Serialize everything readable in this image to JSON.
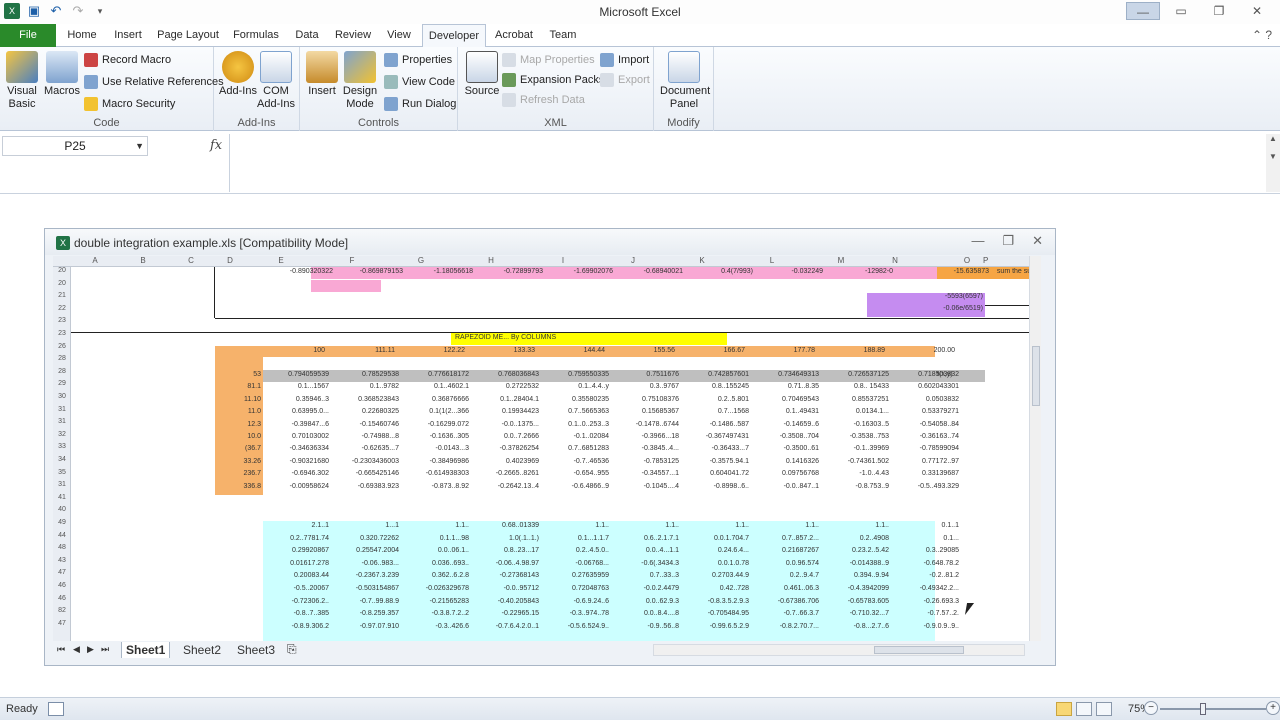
{
  "app": {
    "title": "Microsoft Excel"
  },
  "qat": {
    "save": "save-icon",
    "undo": "undo-icon",
    "redo": "redo-icon",
    "customize": "chevron-down-icon"
  },
  "tabs": [
    "File",
    "Home",
    "Insert",
    "Page Layout",
    "Formulas",
    "Data",
    "Review",
    "View",
    "Developer",
    "Acrobat",
    "Team"
  ],
  "active_tab": "Developer",
  "ribbon": {
    "code": {
      "label": "Code",
      "visual_basic": "Visual Basic",
      "macros": "Macros",
      "record_macro": "Record Macro",
      "relative_refs": "Use Relative References",
      "macro_security": "Macro Security"
    },
    "addins": {
      "label": "Add-Ins",
      "addins": "Add-Ins",
      "com_addins": "COM Add-Ins"
    },
    "controls": {
      "label": "Controls",
      "insert": "Insert",
      "design_mode": "Design Mode",
      "properties": "Properties",
      "view_code": "View Code",
      "run_dialog": "Run Dialog"
    },
    "xml": {
      "label": "XML",
      "source": "Source",
      "map_properties": "Map Properties",
      "expansion_packs": "Expansion Packs",
      "refresh_data": "Refresh Data",
      "import": "Import",
      "export": "Export"
    },
    "modify": {
      "label": "Modify",
      "document_panel": "Document Panel"
    }
  },
  "formula_bar": {
    "name_box": "P25",
    "fx": "fx",
    "formula": ""
  },
  "workbook": {
    "title": "double integration example.xls  [Compatibility Mode]",
    "columns": [
      "A",
      "B",
      "C",
      "D",
      "E",
      "F",
      "G",
      "H",
      "I",
      "J",
      "K",
      "L",
      "M",
      "N",
      "O",
      "P"
    ],
    "rows": [
      "20",
      "20",
      "21",
      "22",
      "23",
      "23",
      "26",
      "28",
      "28",
      "29",
      "30",
      "31",
      "31",
      "32",
      "33",
      "34",
      "35",
      "31",
      "41",
      "40",
      "49",
      "44",
      "48",
      "43",
      "47",
      "46",
      "46",
      "82",
      "47"
    ],
    "section_title": "RAPEZOID ME... By COLUMNS",
    "header_values": [
      "100",
      "111.11",
      "122.22",
      "133.33",
      "144.44",
      "155.56",
      "166.67",
      "177.78",
      "188.89",
      "200.00"
    ],
    "top_row_values": [
      "-0.890320322",
      "-0.869879153",
      "-1.18056618",
      "-0.72899793",
      "-1.69902076",
      "-0.68940021",
      "0.4(7/993)",
      "-0.032249",
      "-12982-0",
      "-15.635873",
      "sum the sum"
    ],
    "right_notes": {
      "a": "-5593(6597)",
      "b": "-0.06e/6519)",
      "fxy": "f(x,y)"
    },
    "orange_rows": [
      [
        "53",
        "0.794059539",
        "0.78529538",
        "0.776618172",
        "0.768036843",
        "0.759550335",
        "0.7511676",
        "0.742857601",
        "0.734649313",
        "0.726537125",
        "0.718503832"
      ],
      [
        "81.1",
        "0.1...1567",
        "0.1..9782",
        "0.1..4602.1",
        "0.2722532",
        "0.1..4.4..y",
        "0.3..9767",
        "0.8..155245",
        "0.71..8.35",
        "0.8.. 15433",
        "0.602043301"
      ],
      [
        "11.10",
        "0.35946..3",
        "0.368523843",
        "0.36876666",
        "0.1..28404.1",
        "0.35580235",
        "0.75108376",
        "0.2..5.801",
        "0.70469543",
        "0.85537251",
        "0.0503832"
      ],
      [
        "11.0",
        "0.63995.0...",
        "0.22680325",
        "0.1(1(2...366",
        "0.19934423",
        "0.7..5665363",
        "0.15685367",
        "0.7...1568",
        "0.1..49431",
        "0.0134.1...",
        "0.53379271"
      ],
      [
        "12.3",
        "-0.39847...6",
        "-0.15460746",
        "-0.16299.072",
        "-0.0..1375...",
        "0.1..0..253..3",
        "-0.1478..6744",
        "-0.1486..587",
        "-0.14659..6",
        "-0.16303..5",
        "-0.54058..84"
      ],
      [
        "10.0",
        "0.70103002",
        "-0.74988...8",
        "-0.1636..305",
        "0.0..7.2666",
        "-0.1..02084",
        "-0.3966...18",
        "-0.367497431",
        "-0.3508..704",
        "-0.3538..753",
        "-0.36163..74"
      ],
      [
        "(36.7",
        "-0.34636334",
        "-0.62635...7",
        "-0.0143...3",
        "-0.37826254",
        "0.7..6851283",
        "-0.3845..4...",
        "-0.36433...7",
        "-0.3500..61",
        "-0.1..39969",
        "-0.78599094"
      ],
      [
        "33.26",
        "-0.90321680",
        "-0.2303436003",
        "-0.38496986",
        "0.4023969",
        "-0.7..46536",
        "-0.7853125",
        "-0.3575.94.1",
        "0.1416326",
        "-0.74361.502",
        "0.77172..97"
      ],
      [
        "236.7",
        "-0.6946.302",
        "-0.665425146",
        "-0.614938303",
        "-0.2665..8261",
        "-0.654..955",
        "-0.34557...1",
        "0.604041.72",
        "0.09756768",
        "-1.0..4.43",
        "0.33139687"
      ],
      [
        "336.8",
        "-0.00958624",
        "-0.69383.923",
        "-0.873..8.92",
        "-0.2642.13..4",
        "-0.6.4866..9",
        "-0.1045....4",
        "-0.8998..6..",
        "-0.0..847..1",
        "-0.8.753..9",
        "-0.5..493.329"
      ]
    ],
    "cyan_rows": [
      [
        "2.1..1",
        "1...1",
        "1.1..",
        "0.68..01339",
        "1.1..",
        "1.1..",
        "1.1..",
        "1.1..",
        "1.1..",
        "0.1..1"
      ],
      [
        "0.2..7781.74",
        "0.320.72262",
        "0.1.1...98",
        "1.0(.1..1.)",
        "0.1...1.1.7",
        "0.6..2.1.7.1",
        "0.0.1.704.7",
        "0.7..857.2...",
        "0.2..4908",
        "0.1..."
      ],
      [
        "0.29920867",
        "0.25547.2004",
        "0.0..06.1..",
        "0.8..23...17",
        "0.2..4.5.0..",
        "0.0..4...1.1",
        "0.24.6.4...",
        "0.21687267",
        "0.23.2..5.42",
        "0.3..29085"
      ],
      [
        "0.01617.278",
        "-0.06..983...",
        "0.036..693..",
        "-0.06..4.98.97",
        "-0.06768...",
        "-0.6(.3434.3",
        "0.0.1.0.78",
        "0.0.96.574",
        "-0.014388..9",
        "-0.648.78.2"
      ],
      [
        "0.20083.44",
        "-0.2367.3.239",
        "0.362..6.2.8",
        "-0.27368143",
        "0.27635959",
        "0.7..33..3",
        "0.2703.44.9",
        "0.2..9.4.7",
        "0.394..9.94",
        "-0.2..81.2"
      ],
      [
        "-0.5..20067",
        "-0.503154867",
        "-0.026329678",
        "-0.0..95712",
        "0.72048763",
        "-0.0.2.4479",
        "0.42..728",
        "0.461..06.3",
        "-0.4.3942099",
        "-0.49342.2..."
      ],
      [
        "-0.72306.2..",
        "-0.7..99.88.9",
        "-0.21565283",
        "-0.40.205843",
        "-0.6.9.24..6",
        "0.0..62.9.3",
        "-0.8.3.5.2.9.3",
        "-0.67386.706",
        "-0.65783.605",
        "-0.26.693.3"
      ],
      [
        "-0.8..7..385",
        "-0.8.259.357",
        "-0.3.8.7.2..2",
        "-0.22965.15",
        "-0.3..974..78",
        "0.0..8.4....8",
        "-0.705484.95",
        "-0.7..66.3.7",
        "-0.710.32...7",
        "-0.7.57..2."
      ],
      [
        "-0.8.9.306.2",
        "-0.97.07.910",
        "-0.3..426.6",
        "-0.7.6.4.2.0..1",
        "-0.5.6.524.9..",
        "-0.9..56..8",
        "-0.99.6.5.2.9",
        "-0.8.2.70.7...",
        "-0.8...2.7..6",
        "-0.9.0.9..9.."
      ]
    ],
    "sheets": [
      "Sheet1",
      "Sheet2",
      "Sheet3"
    ],
    "active_sheet": "Sheet1"
  },
  "status": {
    "ready": "Ready",
    "zoom": "75%"
  },
  "colors": {
    "file_tab": "#2a8a2a",
    "pink": "#f9a8d4",
    "purple": "#c58cf0",
    "orange": "#f6b26b",
    "yellow": "#ffff00",
    "cyan": "#ccffff",
    "gray": "#bfbfbf"
  }
}
